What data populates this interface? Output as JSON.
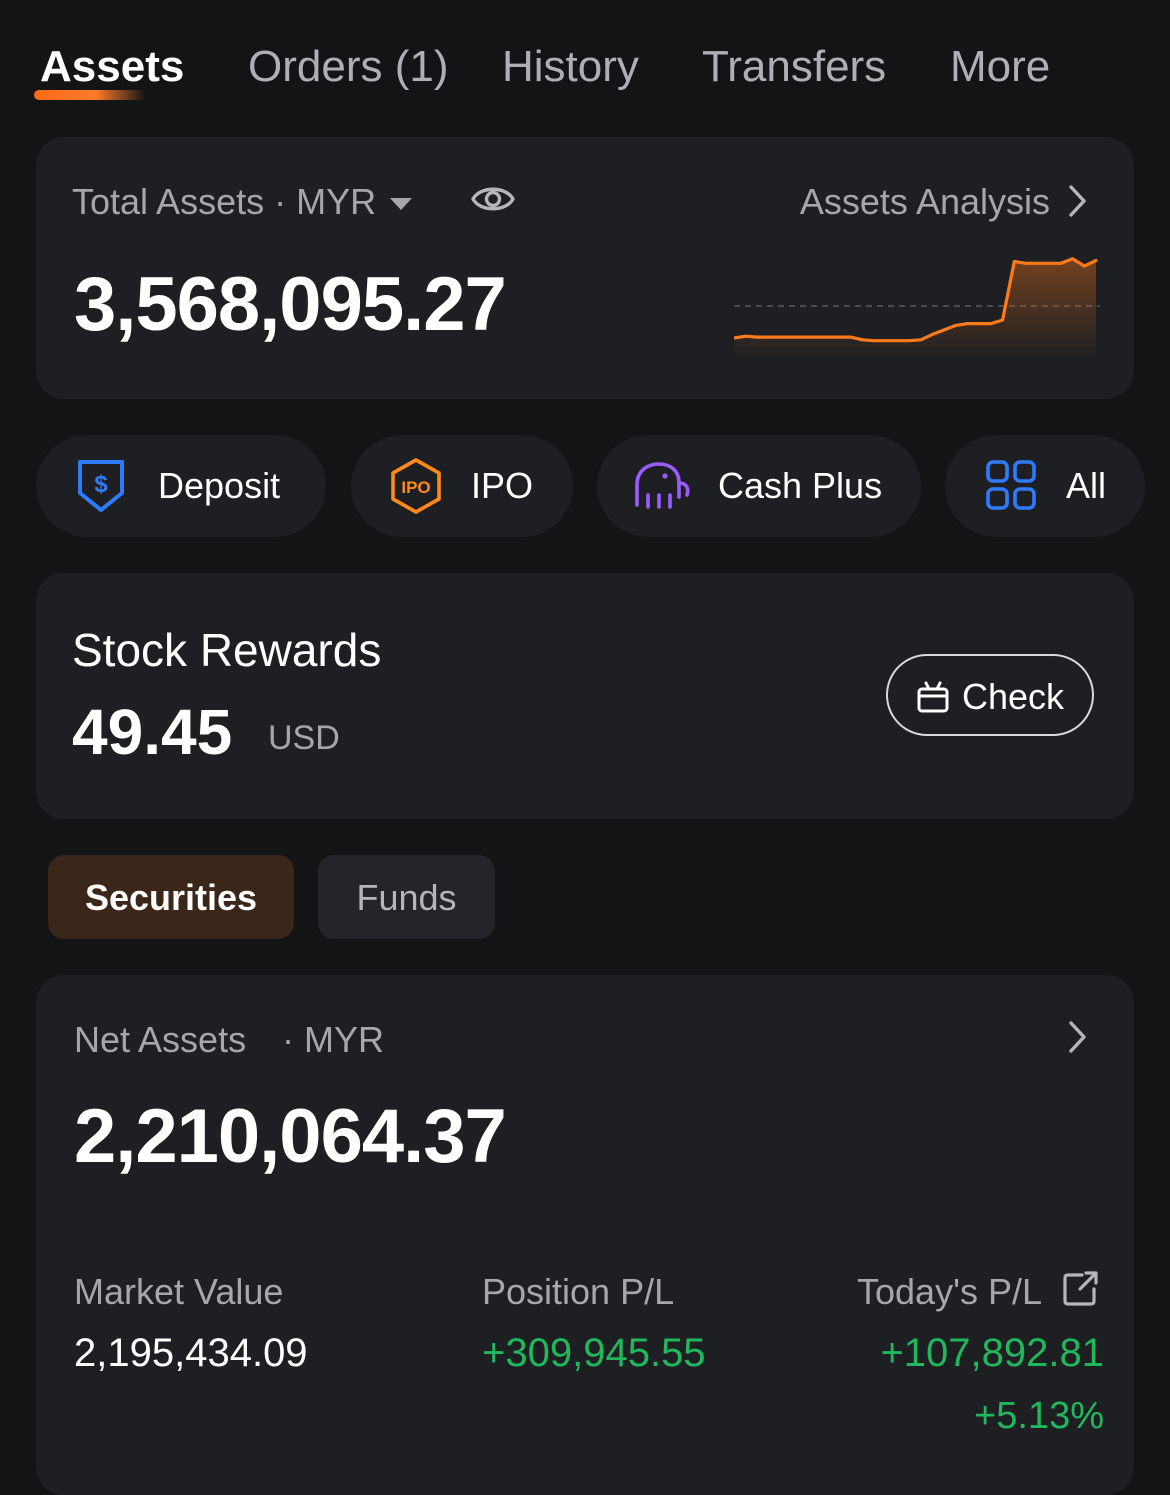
{
  "tabs": [
    {
      "label": "Assets",
      "active": true
    },
    {
      "label": "Orders (1)"
    },
    {
      "label": "History"
    },
    {
      "label": "Transfers"
    },
    {
      "label": "More"
    }
  ],
  "total_assets": {
    "label": "Total Assets",
    "currency": "· MYR",
    "value": "3,568,095.27",
    "analysis_link": "Assets Analysis"
  },
  "sparkline": {
    "color": "#ff7a1a",
    "values": [
      0.1,
      0.12,
      0.11,
      0.11,
      0.11,
      0.11,
      0.11,
      0.11,
      0.11,
      0.11,
      0.11,
      0.08,
      0.07,
      0.07,
      0.07,
      0.07,
      0.08,
      0.14,
      0.19,
      0.24,
      0.26,
      0.26,
      0.26,
      0.3,
      0.95,
      0.93,
      0.93,
      0.93,
      0.93,
      0.98,
      0.9,
      0.96
    ]
  },
  "quick_actions": [
    {
      "label": "Deposit",
      "icon": "deposit-shield-icon",
      "color": "#2f7bff"
    },
    {
      "label": "IPO",
      "icon": "ipo-hexagon-icon",
      "color": "#ff8a1a"
    },
    {
      "label": "Cash Plus",
      "icon": "elephant-icon",
      "color": "#9b5cff"
    },
    {
      "label": "All",
      "icon": "grid-icon",
      "color": "#2f7bff"
    }
  ],
  "rewards": {
    "title": "Stock Rewards",
    "value": "49.45",
    "currency": "USD",
    "check_label": "Check"
  },
  "segments": {
    "securities": "Securities",
    "funds": "Funds"
  },
  "net_assets": {
    "label": "Net Assets",
    "currency": "· MYR",
    "value": "2,210,064.37",
    "market_value_label": "Market Value",
    "market_value": "2,195,434.09",
    "position_pl_label": "Position P/L",
    "position_pl": "+309,945.55",
    "todays_pl_label": "Today's P/L",
    "todays_pl": "+107,892.81",
    "todays_pl_pct": "+5.13%"
  }
}
